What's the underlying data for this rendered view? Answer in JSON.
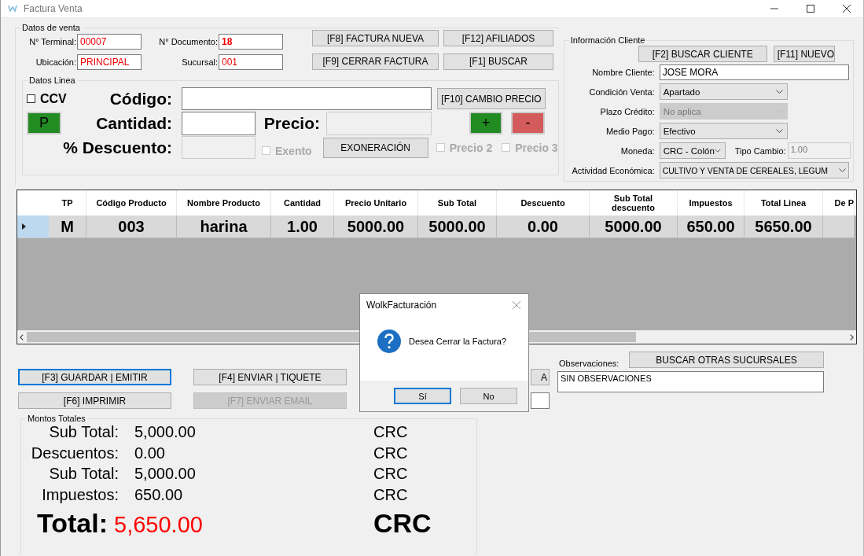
{
  "window": {
    "title": "Factura Venta"
  },
  "datos_venta": {
    "legend": "Datos de venta",
    "fields": [
      {
        "label": "N° Terminal:",
        "value": "00007",
        "bold": false
      },
      {
        "label": "N° Documento:",
        "value": "18",
        "bold": true
      },
      {
        "label": "Ubicación:",
        "value": "PRINCIPAL",
        "bold": false
      },
      {
        "label": "Sucursal:",
        "value": "001",
        "bold": false
      }
    ],
    "buttons": [
      "[F8] FACTURA NUEVA",
      "[F12] AFILIADOS",
      "[F9] CERRAR FACTURA",
      "[F1] BUSCAR"
    ]
  },
  "datos_linea": {
    "legend": "Datos Linea",
    "ccv": {
      "label": "CCV",
      "checked": false
    },
    "p_button": "P",
    "codigo_label": "Código:",
    "cantidad_label": "Cantidad:",
    "precio_label": "Precio:",
    "descuento_label": "% Descuento:",
    "cambio_precio": "[F10] CAMBIO PRECIO",
    "plus": "+",
    "minus": "-",
    "exoneracion": "EXONERACIÓN",
    "checks": [
      {
        "label": "Exento",
        "checked": false,
        "disabled": true
      },
      {
        "label": "Precio 2",
        "checked": false,
        "disabled": true
      },
      {
        "label": "Precio 3",
        "checked": false,
        "disabled": true
      }
    ]
  },
  "cliente": {
    "legend": "Información Cliente",
    "buttons": [
      "[F2] BUSCAR CLIENTE",
      "[F11] NUEVO"
    ],
    "fields": [
      {
        "label": "Nombre Cliente:",
        "value": "JOSE  MORA",
        "kind": "text",
        "disabled": false
      },
      {
        "label": "Condición Venta:",
        "value": "Apartado",
        "kind": "select",
        "disabled": false
      },
      {
        "label": "Plazo Crédito:",
        "value": "No aplica",
        "kind": "select",
        "disabled": true
      },
      {
        "label": "Medio Pago:",
        "value": "Efectivo",
        "kind": "select",
        "disabled": false
      },
      {
        "label": "Moneda:",
        "value": "CRC - Colón",
        "kind": "currency",
        "disabled": false,
        "extra_label": "Tipo Cambio:",
        "extra_value": "1.00"
      },
      {
        "label": "Actividad Económica:",
        "value": "CULTIVO Y VENTA DE CEREALES, LEGUM",
        "kind": "wide",
        "disabled": false
      }
    ]
  },
  "grid": {
    "columns": [
      "TP",
      "Código Producto",
      "Nombre Producto",
      "Cantidad",
      "Precio Unitario",
      "Sub Total",
      "Descuento",
      "Sub Total descuento",
      "Impuestos",
      "Total Linea",
      "De P"
    ],
    "rows": [
      {
        "selected": true,
        "cells": [
          "M",
          "003",
          "harina",
          "1.00",
          "5000.00",
          "5000.00",
          "0.00",
          "5000.00",
          "650.00",
          "5650.00",
          ""
        ]
      }
    ]
  },
  "acciones": {
    "buttons": [
      {
        "label": "[F3] GUARDAR | EMITIR",
        "focused": true,
        "disabled": false
      },
      {
        "label": "[F4] ENVIAR | TIQUETE",
        "focused": false,
        "disabled": false
      },
      {
        "label": "[F6] IMPRIMIR",
        "focused": false,
        "disabled": false
      },
      {
        "label": "[F7] ENVIAR EMAIL",
        "focused": false,
        "disabled": true
      }
    ],
    "hidden_button": "A"
  },
  "observaciones": {
    "label": "Observaciones:",
    "value": "SIN OBSERVACIONES",
    "button": "BUSCAR OTRAS SUCURSALES"
  },
  "totales": {
    "legend": "Montos Totales",
    "rows": [
      {
        "label": "Sub Total:",
        "value": "5,000.00",
        "currency": "CRC"
      },
      {
        "label": "Descuentos:",
        "value": "0.00",
        "currency": "CRC"
      },
      {
        "label": "Sub Total:",
        "value": "5,000.00",
        "currency": "CRC"
      },
      {
        "label": "Impuestos:",
        "value": "650.00",
        "currency": "CRC"
      }
    ],
    "total": {
      "label": "Total:",
      "value": "5,650.00",
      "currency": "CRC"
    }
  },
  "dialog": {
    "title": "WolkFacturación",
    "message": "Desea Cerrar la Factura?",
    "buttons": [
      {
        "label": "Sí",
        "selected": true
      },
      {
        "label": "No",
        "selected": false
      }
    ]
  }
}
